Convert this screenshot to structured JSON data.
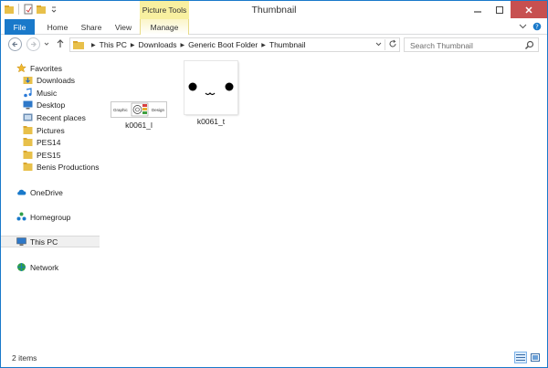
{
  "window": {
    "title": "Thumbnail",
    "contextual_group": "Picture Tools"
  },
  "ribbon": {
    "tabs": [
      "File",
      "Home",
      "Share",
      "View",
      "Manage"
    ]
  },
  "address": {
    "crumbs": [
      "This PC",
      "Downloads",
      "Generic Boot Folder",
      "Thumbnail"
    ]
  },
  "search": {
    "placeholder": "Search Thumbnail"
  },
  "navpane": {
    "favorites_label": "Favorites",
    "favorites": [
      "Downloads",
      "Music",
      "Desktop",
      "Recent places",
      "Pictures",
      "PES14",
      "PES15",
      "Benis Productions"
    ],
    "onedrive": "OneDrive",
    "homegroup": "Homegroup",
    "thispc": "This PC",
    "network": "Network"
  },
  "files": [
    {
      "name": "k0061_l",
      "thumb_left_text": "Graphic",
      "thumb_right_text": "Design"
    },
    {
      "name": "k0061_t"
    }
  ],
  "status": {
    "item_count": "2 items"
  },
  "colors": {
    "accent": "#1979ca",
    "contextual": "#f8f0a0",
    "close": "#c75050"
  }
}
